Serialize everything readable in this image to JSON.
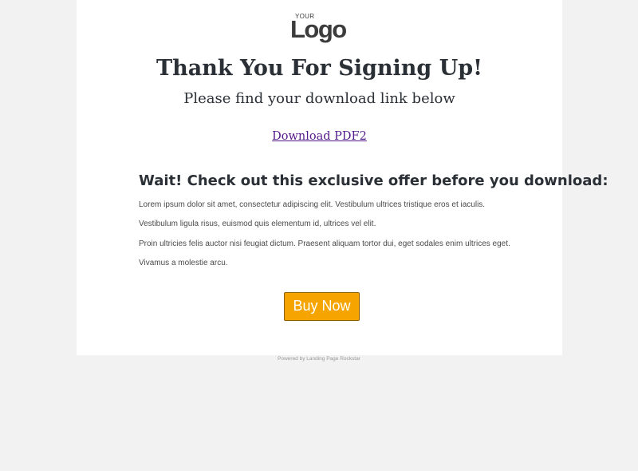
{
  "logo": {
    "small_text": "YOUR",
    "big_text": "Logo"
  },
  "header": {
    "title": "Thank You For Signing Up!",
    "subtitle": "Please find your download link below"
  },
  "download": {
    "link_label": "Download PDF2"
  },
  "offer": {
    "heading": "Wait! Check out this exclusive offer before you download:",
    "paragraphs": [
      "Lorem ipsum dolor sit amet, consectetur adipiscing elit. Vestibulum ultrices tristique eros et iaculis.",
      "Vestibulum ligula risus, euismod quis elementum id, ultrices vel elit.",
      "Proin ultricies felis auctor nisi feugiat dictum. Praesent aliquam tortor dui, eget sodales enim ultrices eget.",
      "Vivamus a molestie arcu."
    ],
    "button_label": "Buy Now"
  },
  "footer": {
    "text": "Powered by Landing Page Rockstar"
  },
  "colors": {
    "page_background": "#f2f2f2",
    "content_background": "#ffffff",
    "heading_text": "#2b3036",
    "link_visited": "#551a8b",
    "button_background": "#f5a400",
    "button_border": "#8a5d00"
  }
}
